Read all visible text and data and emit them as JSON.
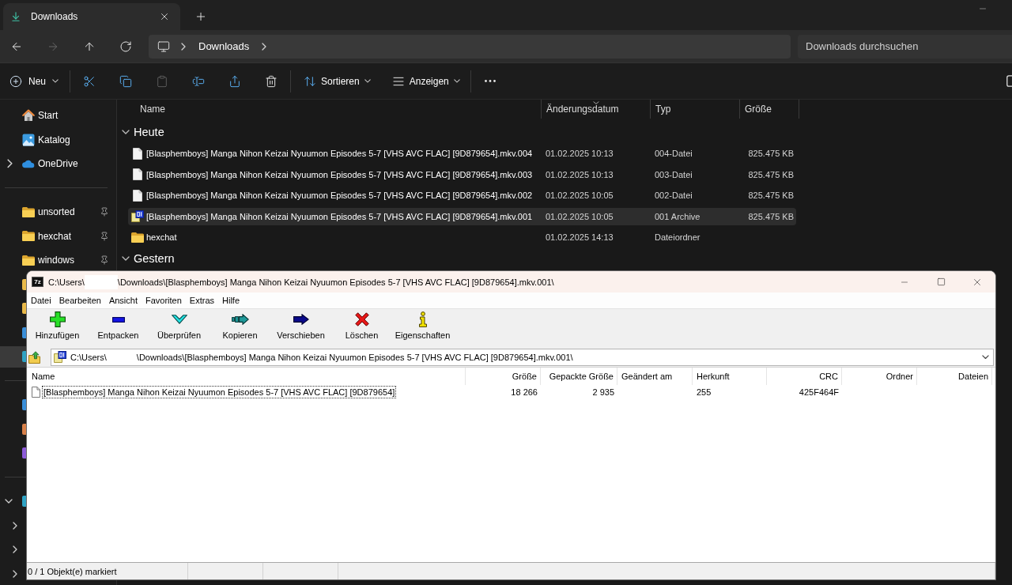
{
  "tab": {
    "title": "Downloads"
  },
  "nav_buttons": [
    {
      "kind": "back",
      "disabled": false
    },
    {
      "kind": "forward",
      "disabled": true
    },
    {
      "kind": "up",
      "disabled": false
    },
    {
      "kind": "refresh",
      "disabled": false
    }
  ],
  "address_bar": {
    "segments": [
      "Downloads"
    ]
  },
  "search": {
    "placeholder": "Downloads durchsuchen"
  },
  "command_bar": {
    "groups": [
      {
        "items": [
          {
            "kind": "new",
            "label": "Neu",
            "disabled": false
          }
        ]
      },
      {
        "items": [
          {
            "kind": "cut",
            "disabled": false
          },
          {
            "kind": "copy",
            "disabled": false
          },
          {
            "kind": "paste",
            "disabled": true
          },
          {
            "kind": "rename",
            "disabled": false
          },
          {
            "kind": "share",
            "disabled": false
          },
          {
            "kind": "delete",
            "disabled": false
          }
        ]
      },
      {
        "items": [
          {
            "kind": "sort",
            "label": "Sortieren",
            "disabled": false
          },
          {
            "kind": "view",
            "label": "Anzeigen",
            "disabled": false
          }
        ]
      },
      {
        "items": [
          {
            "kind": "more",
            "disabled": false
          }
        ]
      }
    ],
    "trailing": [
      {
        "kind": "details"
      }
    ]
  },
  "sidebar": {
    "quick_items": [
      {
        "kind": "home",
        "label": "Start"
      },
      {
        "kind": "gallery",
        "label": "Katalog"
      }
    ],
    "cloud_items": [
      {
        "label": "OneDrive",
        "expanded": false
      }
    ],
    "pinned": [
      {
        "label": "unsorted",
        "pinned": true
      },
      {
        "label": "hexchat",
        "pinned": true
      },
      {
        "label": "windows",
        "pinned": true
      }
    ],
    "covered_sections": [
      {
        "rows": [
          {
            "color": "#e9b949",
            "selected": false
          },
          {
            "color": "#e9b949",
            "selected": false
          },
          {
            "color": "#3a8fd9",
            "selected": false
          },
          {
            "color": "#2fa3c4",
            "selected": true
          }
        ]
      },
      {
        "rows": [
          {
            "color": "#3a8fd9",
            "selected": false
          },
          {
            "color": "#d9814a",
            "selected": false
          },
          {
            "color": "#8d5bd9",
            "selected": false
          }
        ]
      }
    ],
    "tree": [
      {
        "expanded": true,
        "color": "#2fa3c4",
        "children": [
          {
            "expanded": false
          },
          {
            "expanded": false
          },
          {
            "expanded": false
          }
        ]
      }
    ]
  },
  "file_list": {
    "columns": [
      {
        "label": "Name",
        "sorted": false
      },
      {
        "label": "Änderungsdatum",
        "sorted": true
      },
      {
        "label": "Typ",
        "sorted": false
      },
      {
        "label": "Größe",
        "sorted": false
      }
    ],
    "groups": [
      {
        "label": "Heute",
        "expanded": true,
        "rows": [
          {
            "kind": "file",
            "name": "[Blasphemboys] Manga Nihon Keizai Nyuumon Episodes 5-7 [VHS AVC FLAC] [9D879654].mkv.004",
            "date": "01.02.2025 10:13",
            "type": "004-Datei",
            "size": "825.475 KB",
            "selected": false
          },
          {
            "kind": "file",
            "name": "[Blasphemboys] Manga Nihon Keizai Nyuumon Episodes 5-7 [VHS AVC FLAC] [9D879654].mkv.003",
            "date": "01.02.2025 10:13",
            "type": "003-Datei",
            "size": "825.475 KB",
            "selected": false
          },
          {
            "kind": "file",
            "name": "[Blasphemboys] Manga Nihon Keizai Nyuumon Episodes 5-7 [VHS AVC FLAC] [9D879654].mkv.002",
            "date": "01.02.2025 10:05",
            "type": "002-Datei",
            "size": "825.475 KB",
            "selected": false
          },
          {
            "kind": "archive",
            "name": "[Blasphemboys] Manga Nihon Keizai Nyuumon Episodes 5-7 [VHS AVC FLAC] [9D879654].mkv.001",
            "date": "01.02.2025 10:05",
            "type": "001 Archive",
            "size": "825.475 KB",
            "selected": true
          },
          {
            "kind": "folder",
            "name": "hexchat",
            "date": "01.02.2025 14:13",
            "type": "Dateiordner",
            "selected": false
          }
        ]
      },
      {
        "label": "Gestern",
        "expanded": true
      }
    ]
  },
  "archive_window": {
    "app_icon_label": "7z",
    "title_parts": [
      "C:\\Users\\",
      "\\Downloads\\[Blasphemboys] Manga Nihon Keizai Nyuumon Episodes 5-7 [VHS AVC FLAC] [9D879654].mkv.001\\"
    ],
    "menu": [
      "Datei",
      "Bearbeiten",
      "Ansicht",
      "Favoriten",
      "Extras",
      "Hilfe"
    ],
    "toolbar": [
      {
        "kind": "add",
        "label": "Hinzufügen"
      },
      {
        "kind": "extract",
        "label": "Entpacken"
      },
      {
        "kind": "test",
        "label": "Überprüfen"
      },
      {
        "kind": "copy",
        "label": "Kopieren"
      },
      {
        "kind": "move",
        "label": "Verschieben"
      },
      {
        "kind": "delete",
        "label": "Löschen"
      },
      {
        "kind": "info",
        "label": "Eigenschaften"
      }
    ],
    "path_parts": [
      "C:\\Users\\",
      "\\Downloads\\[Blasphemboys] Manga Nihon Keizai Nyuumon Episodes 5-7 [VHS AVC FLAC] [9D879654].mkv.001\\"
    ],
    "columns": [
      "Name",
      "Größe",
      "Gepackte Größe",
      "Geändert am",
      "Herkunft",
      "CRC",
      "Ordner",
      "Dateien"
    ],
    "rows": [
      {
        "name": "[Blasphemboys] Manga Nihon Keizai Nyuumon Episodes 5-7 [VHS AVC FLAC] [9D879654]",
        "size": "18 266",
        "packed_size": "2 935",
        "origin": "255",
        "crc": "425F464F",
        "focused": true
      }
    ],
    "status_bar": {
      "text": "0 / 1 Objekt(e) markiert"
    }
  }
}
